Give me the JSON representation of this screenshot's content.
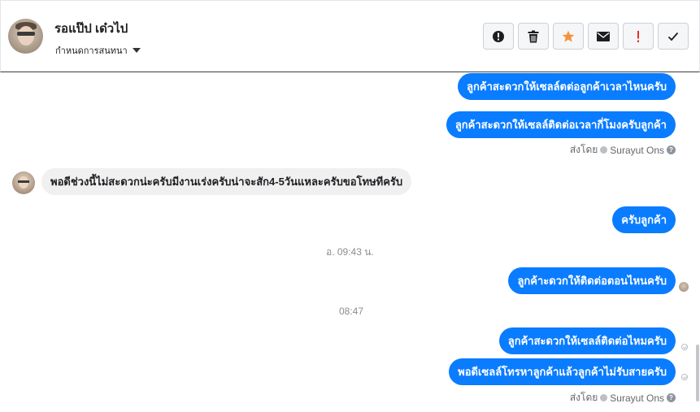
{
  "header": {
    "contact_name": "รอแป๊ป เด๋วไป",
    "assign_label": "กำหนดการสนทนา",
    "toolbar": [
      {
        "name": "report-button",
        "icon": "exclamation-circle-icon"
      },
      {
        "name": "delete-button",
        "icon": "trash-icon"
      },
      {
        "name": "star-button",
        "icon": "star-icon",
        "color": "#f7923b"
      },
      {
        "name": "email-button",
        "icon": "envelope-icon"
      },
      {
        "name": "spam-button",
        "icon": "exclamation-icon",
        "color": "#e4312b"
      },
      {
        "name": "done-button",
        "icon": "check-icon"
      }
    ]
  },
  "messages": [
    {
      "text": "ลูกค้าสะดวกให้เซลล์ตต่อลูกค้าเวลาไหนครับ"
    },
    {
      "text": "ลูกค้าสะดวกให้เซลล์ติดต่อเวลากี่โมงครับลูกค้า"
    },
    {
      "text": "พอดีช่วงนี้ไม่สะดวกน่ะครับมีงานเร่งครับน่าจะสัก4-5วันแหละครับขอโทษทีครับ"
    },
    {
      "text": "ครับลูกค้า"
    },
    {
      "text": "ลูกค้าะดวกให้ติดต่อตอนไหนครับ"
    },
    {
      "text": "ลูกค้าสะดวกให้เซลล์ติดต่อไหมครับ"
    },
    {
      "text": "พอดีเซลล์โทรหาลูกค้าแล้วลูกค้าไม่รับสายครับ"
    }
  ],
  "sent_by": {
    "prefix": "ส่งโดย",
    "name": "Surayut Ons"
  },
  "timestamps": [
    "อ. 09:43 น.",
    "08:47"
  ],
  "colors": {
    "outgoing_bubble": "#0a7cff",
    "incoming_bubble": "#f0f0f0"
  }
}
